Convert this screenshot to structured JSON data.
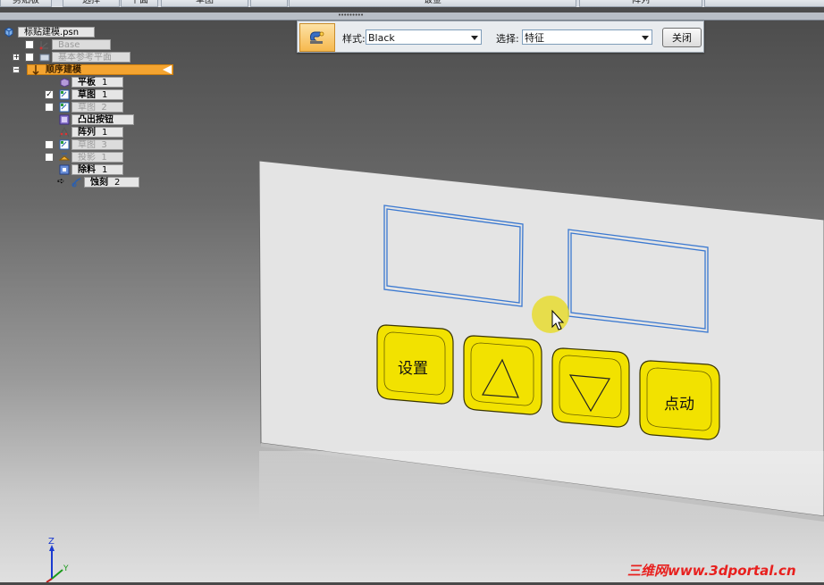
{
  "ribbon": {
    "tabs": [
      "剪贴板",
      "选择",
      "平面",
      "草图",
      "",
      "钣金",
      "",
      "阵列",
      ""
    ]
  },
  "handle": {
    "grip": "•••••••••"
  },
  "command_bar": {
    "style_label": "样式:",
    "style_value": "Black",
    "select_label": "选择:",
    "select_value": "特征",
    "close_label": "关闭"
  },
  "tree": {
    "root": "标贴建模.psn",
    "items": [
      {
        "label": "Base",
        "style": "gray"
      },
      {
        "label": "基本参考平面",
        "style": "gray"
      },
      {
        "label": "顺序建模",
        "style": "orange"
      },
      {
        "label": "平板",
        "num": "1",
        "style": "bold"
      },
      {
        "label": "草图",
        "num": "1",
        "style": "bold"
      },
      {
        "label": "草图",
        "num": "2",
        "style": "gray"
      },
      {
        "label": "凸出按钮",
        "num": "",
        "style": "bold"
      },
      {
        "label": "阵列",
        "num": "1",
        "style": "bold"
      },
      {
        "label": "草图",
        "num": "3",
        "style": "gray"
      },
      {
        "label": "投影",
        "num": "1",
        "style": "gray"
      },
      {
        "label": "除料",
        "num": "1",
        "style": "bold"
      },
      {
        "label": "蚀刻",
        "num": "2",
        "style": "bold"
      }
    ]
  },
  "model": {
    "buttons": [
      {
        "label": "设置"
      },
      {
        "label": "△"
      },
      {
        "label": "▽"
      },
      {
        "label": "点动"
      }
    ]
  },
  "triad": {
    "z": "Z",
    "y": "Y"
  },
  "watermark": "三维网www.3dportal.cn",
  "colors": {
    "accent": "#f4a430",
    "button_yellow": "#f2e200",
    "sketch_blue": "#3a78d0",
    "panel": "#e4e4e4"
  }
}
